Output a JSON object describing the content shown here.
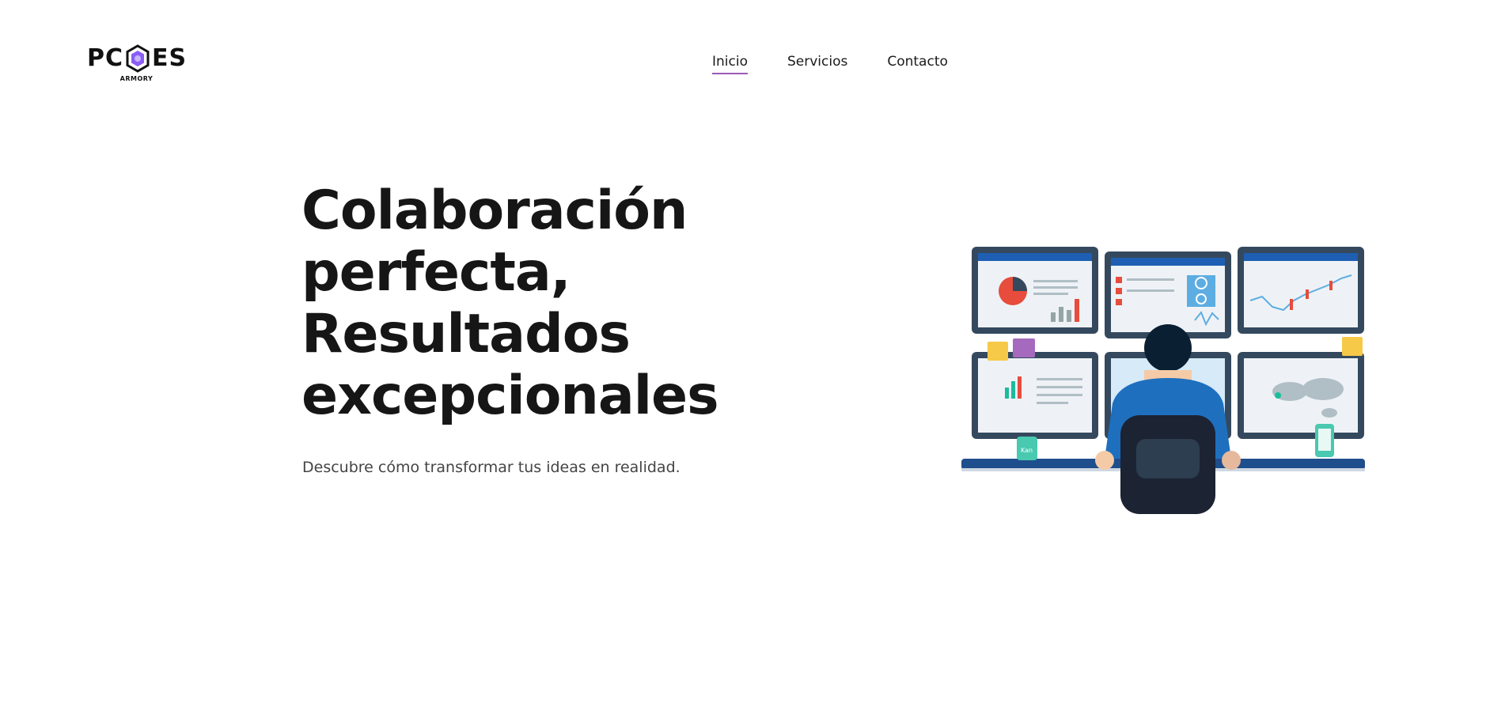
{
  "brand": {
    "name_left": "PC",
    "name_right": "ES",
    "tagline": "ARMORY",
    "accent_color": "#8b5cf6",
    "icon": "hexagon-logo-icon"
  },
  "nav": {
    "items": [
      {
        "label": "Inicio",
        "active": true
      },
      {
        "label": "Servicios",
        "active": false
      },
      {
        "label": "Contacto",
        "active": false
      }
    ],
    "active_underline_color": "#9b59b6"
  },
  "hero": {
    "title_lines": [
      "Colaboración",
      "perfecta,",
      "Resultados",
      "excepcionales"
    ],
    "subtitle": "Descubre cómo transformar tus ideas en realidad."
  },
  "illustration": {
    "icon": "analyst-multi-monitor-illustration",
    "mug_text": "Kan"
  }
}
